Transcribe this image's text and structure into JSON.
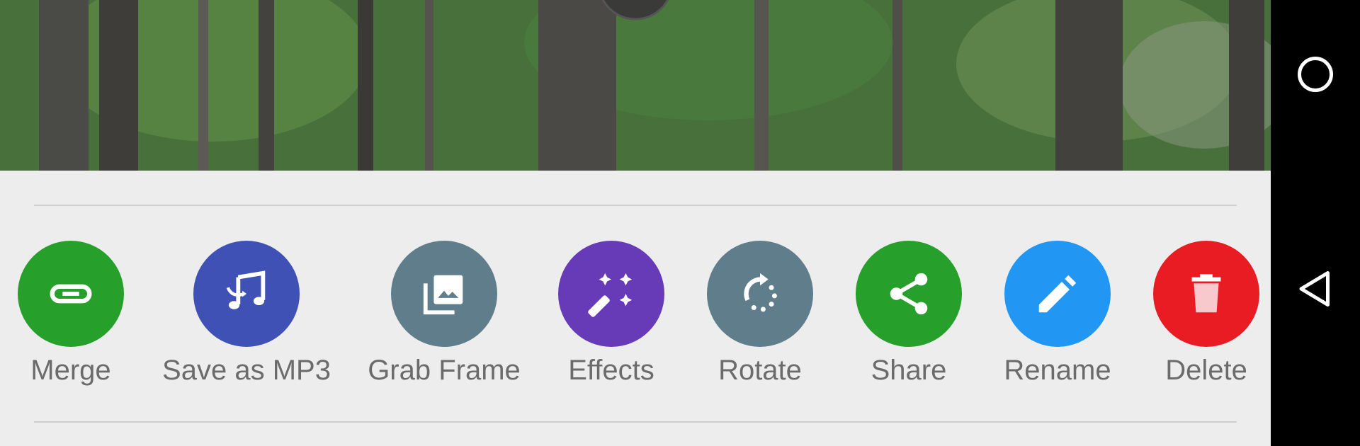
{
  "actions": [
    {
      "label": "Merge",
      "icon": "link-icon",
      "color": "#26a02a"
    },
    {
      "label": "Save as MP3",
      "icon": "music-convert-icon",
      "color": "#3f51b5"
    },
    {
      "label": "Grab Frame",
      "icon": "photo-library-icon",
      "color": "#607d8b"
    },
    {
      "label": "Effects",
      "icon": "magic-wand-icon",
      "color": "#673ab7"
    },
    {
      "label": "Rotate",
      "icon": "rotate-icon",
      "color": "#607d8b"
    },
    {
      "label": "Share",
      "icon": "share-icon",
      "color": "#26a02a"
    },
    {
      "label": "Rename",
      "icon": "pencil-icon",
      "color": "#2196f3"
    },
    {
      "label": "Delete",
      "icon": "trash-icon",
      "color": "#e91c24"
    }
  ],
  "navbar": {
    "home_icon": "home-circle-icon",
    "back_icon": "back-triangle-icon"
  }
}
